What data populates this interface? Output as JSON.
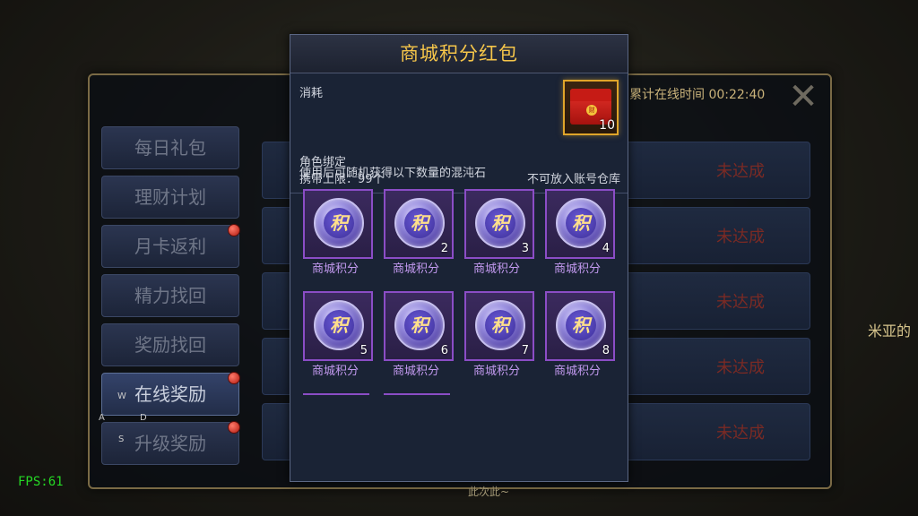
{
  "background": {
    "sidebar": [
      {
        "label": "每日礼包",
        "active": false,
        "dot": false
      },
      {
        "label": "理财计划",
        "active": false,
        "dot": false
      },
      {
        "label": "月卡返利",
        "active": false,
        "dot": true
      },
      {
        "label": "精力找回",
        "active": false,
        "dot": false
      },
      {
        "label": "奖励找回",
        "active": false,
        "dot": false
      },
      {
        "label": "在线奖励",
        "active": true,
        "dot": true
      },
      {
        "label": "升级奖励",
        "active": false,
        "dot": true
      }
    ],
    "rows": [
      {
        "status": "未达成"
      },
      {
        "status": "未达成"
      },
      {
        "status": "未达成"
      },
      {
        "status": "未达成"
      },
      {
        "status": "未达成"
      }
    ],
    "online_time": "累计在线时间 00:22:40",
    "right_edge_text": "米亚的",
    "bottom_text": "此次此~"
  },
  "wasd": {
    "w": "W",
    "a": "A",
    "s": "S",
    "d": "D"
  },
  "fps": "FPS:61",
  "popup": {
    "title": "商城积分红包",
    "consume_label": "消耗",
    "bind_label": "角色绑定",
    "limit_label": "携带上限：99个",
    "warehouse_label": "不可放入账号仓库",
    "item_count": "10",
    "seal_char": "财",
    "description": "使用后可随机获得以下数量的混沌石",
    "rewards": [
      {
        "name": "商城积分",
        "qty": ""
      },
      {
        "name": "商城积分",
        "qty": "2"
      },
      {
        "name": "商城积分",
        "qty": "3"
      },
      {
        "name": "商城积分",
        "qty": "4"
      },
      {
        "name": "商城积分",
        "qty": "5"
      },
      {
        "name": "商城积分",
        "qty": "6"
      },
      {
        "name": "商城积分",
        "qty": "7"
      },
      {
        "name": "商城积分",
        "qty": "8"
      }
    ],
    "coin_char": "积"
  }
}
